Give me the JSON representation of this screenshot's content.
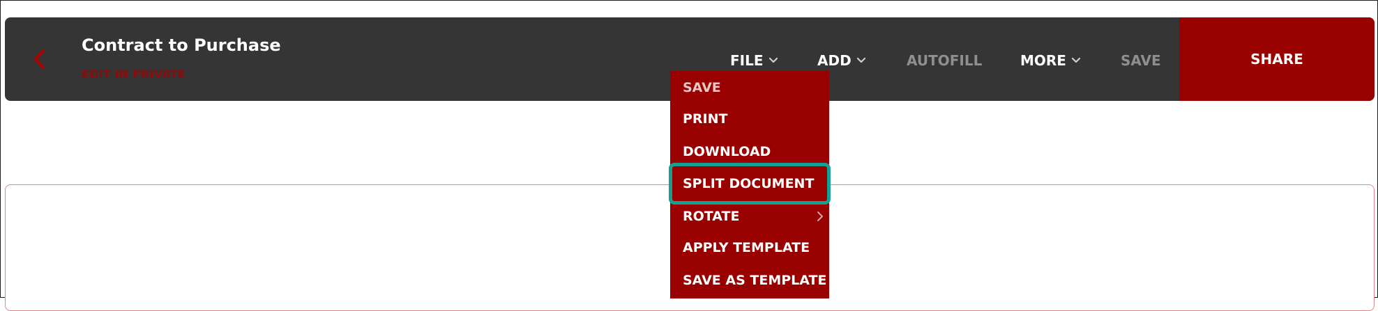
{
  "header": {
    "title": "Contract to Purchase",
    "subtitle": "EDIT IN PRIVATE",
    "back_icon": "chevron-left-icon"
  },
  "nav": {
    "file": "FILE",
    "add": "ADD",
    "autofill": "AUTOFILL",
    "more": "MORE",
    "save": "SAVE",
    "share": "SHARE"
  },
  "file_menu": {
    "items": [
      {
        "label": "SAVE"
      },
      {
        "label": "PRINT"
      },
      {
        "label": "DOWNLOAD"
      },
      {
        "label": "SPLIT DOCUMENT",
        "highlighted": true
      },
      {
        "label": "ROTATE",
        "has_submenu": true
      },
      {
        "label": "APPLY TEMPLATE"
      },
      {
        "label": "SAVE AS TEMPLATE"
      }
    ]
  },
  "colors": {
    "topbar": "#353535",
    "brand_red": "#990000",
    "subtitle_red": "#8a0c0c",
    "highlight": "#17a090",
    "disabled_text": "#8f8f8f"
  }
}
